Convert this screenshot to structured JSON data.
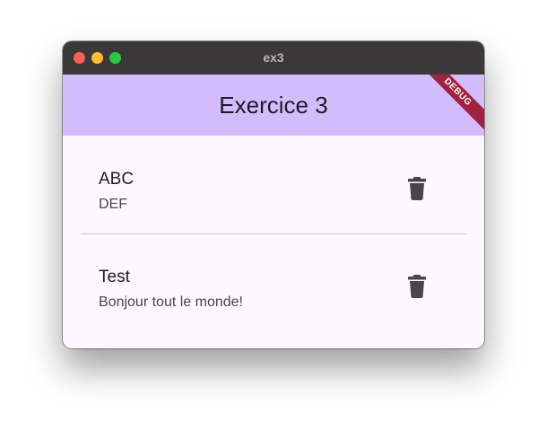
{
  "window": {
    "title": "ex3"
  },
  "appbar": {
    "title": "Exercice 3",
    "debug_banner": "DEBUG",
    "color": "#d3bcfd"
  },
  "list": {
    "items": [
      {
        "title": "ABC",
        "subtitle": "DEF",
        "action_icon": "trash-icon"
      },
      {
        "title": "Test",
        "subtitle": "Bonjour tout le monde!",
        "action_icon": "trash-icon"
      }
    ]
  }
}
